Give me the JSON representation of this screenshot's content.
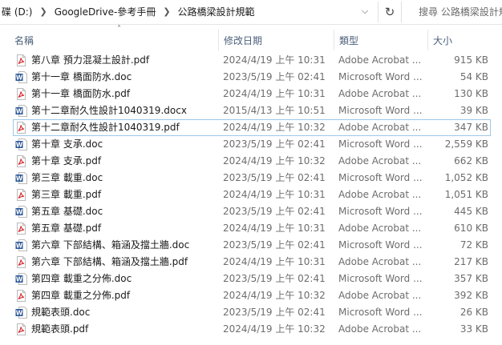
{
  "address": {
    "crumbs": [
      "碟 (D:)",
      "GoogleDrive-參考手冊",
      "公路橋梁設計規範"
    ],
    "search_placeholder": "搜尋 公路橋梁設計規範"
  },
  "columns": {
    "name": "名稱",
    "date": "修改日期",
    "type": "類型",
    "size": "大小"
  },
  "files": [
    {
      "name": "第八章 預力混凝土設計.pdf",
      "date": "2024/4/19 上午 10:31",
      "type": "Adobe Acrobat ...",
      "size": "915 KB",
      "icon": "pdf-icon"
    },
    {
      "name": "第十一章 橋面防水.doc",
      "date": "2023/5/19 上午 02:41",
      "type": "Microsoft Word ...",
      "size": "54 KB",
      "icon": "word-icon"
    },
    {
      "name": "第十一章 橋面防水.pdf",
      "date": "2024/4/19 上午 10:31",
      "type": "Adobe Acrobat ...",
      "size": "130 KB",
      "icon": "pdf-icon"
    },
    {
      "name": "第十二章耐久性設計1040319.docx",
      "date": "2015/4/13 上午 10:51",
      "type": "Microsoft Word ...",
      "size": "39 KB",
      "icon": "word-icon"
    },
    {
      "name": "第十二章耐久性設計1040319.pdf",
      "date": "2024/4/19 上午 10:32",
      "type": "Adobe Acrobat ...",
      "size": "347 KB",
      "icon": "pdf-icon",
      "selected": true
    },
    {
      "name": "第十章 支承.doc",
      "date": "2023/5/19 上午 02:41",
      "type": "Microsoft Word ...",
      "size": "2,559 KB",
      "icon": "word-icon"
    },
    {
      "name": "第十章 支承.pdf",
      "date": "2024/4/19 上午 10:32",
      "type": "Adobe Acrobat ...",
      "size": "662 KB",
      "icon": "pdf-icon"
    },
    {
      "name": "第三章 載重.doc",
      "date": "2023/5/19 上午 02:41",
      "type": "Microsoft Word ...",
      "size": "1,052 KB",
      "icon": "word-icon"
    },
    {
      "name": "第三章 載重.pdf",
      "date": "2024/4/19 上午 10:31",
      "type": "Adobe Acrobat ...",
      "size": "1,051 KB",
      "icon": "pdf-icon"
    },
    {
      "name": "第五章 基礎.doc",
      "date": "2023/5/19 上午 02:41",
      "type": "Microsoft Word ...",
      "size": "445 KB",
      "icon": "word-icon"
    },
    {
      "name": "第五章 基礎.pdf",
      "date": "2024/4/19 上午 10:31",
      "type": "Adobe Acrobat ...",
      "size": "610 KB",
      "icon": "pdf-icon"
    },
    {
      "name": "第六章 下部結構、箱涵及擋土牆.doc",
      "date": "2023/5/19 上午 02:41",
      "type": "Microsoft Word ...",
      "size": "72 KB",
      "icon": "word-icon"
    },
    {
      "name": "第六章 下部結構、箱涵及擋土牆.pdf",
      "date": "2024/4/19 上午 10:31",
      "type": "Adobe Acrobat ...",
      "size": "217 KB",
      "icon": "pdf-icon"
    },
    {
      "name": "第四章 載重之分佈.doc",
      "date": "2023/5/19 上午 02:41",
      "type": "Microsoft Word ...",
      "size": "357 KB",
      "icon": "word-icon"
    },
    {
      "name": "第四章 載重之分佈.pdf",
      "date": "2024/4/19 上午 10:32",
      "type": "Adobe Acrobat ...",
      "size": "392 KB",
      "icon": "pdf-icon"
    },
    {
      "name": "規範表頭.doc",
      "date": "2023/5/19 上午 02:41",
      "type": "Microsoft Word ...",
      "size": "26 KB",
      "icon": "word-icon"
    },
    {
      "name": "規範表頭.pdf",
      "date": "2024/4/19 上午 10:32",
      "type": "Adobe Acrobat ...",
      "size": "33 KB",
      "icon": "pdf-icon"
    }
  ],
  "colors": {
    "pdf": "#d9252b",
    "word": "#2b5797",
    "selected_border": "#9dc7ea",
    "header_text": "#4c607a"
  }
}
